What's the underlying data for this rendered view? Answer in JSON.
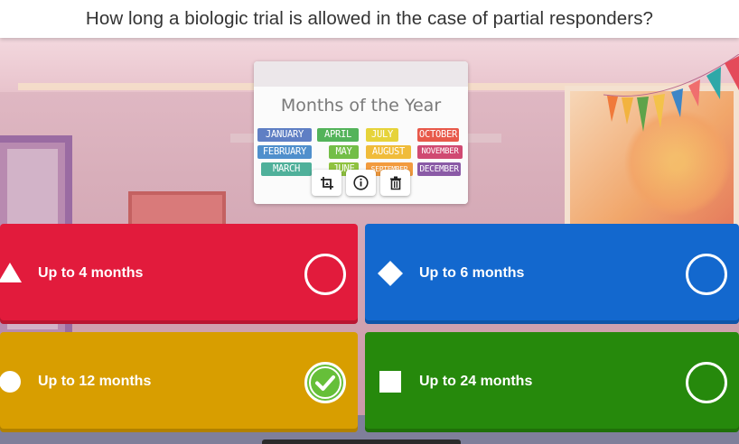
{
  "question": {
    "text": "How long a biologic trial is allowed in the case of partial responders?"
  },
  "media": {
    "title": "Months of the Year",
    "months": [
      {
        "label": "JANUARY",
        "color": "#5f7fc4"
      },
      {
        "label": "FEBRUARY",
        "color": "#4f8fcc"
      },
      {
        "label": "MARCH",
        "color": "#4fb09a"
      },
      {
        "label": "APRIL",
        "color": "#53b35a"
      },
      {
        "label": "MAY",
        "color": "#73be47"
      },
      {
        "label": "JUNE",
        "color": "#8fc23f"
      },
      {
        "label": "JULY",
        "color": "#e6d33a"
      },
      {
        "label": "AUGUST",
        "color": "#f0bc3a"
      },
      {
        "label": "SEPTEMBER",
        "color": "#f29b3e"
      },
      {
        "label": "OCTOBER",
        "color": "#e8594a"
      },
      {
        "label": "NOVEMBER",
        "color": "#d04a72"
      },
      {
        "label": "DECEMBER",
        "color": "#8a5aa6"
      }
    ],
    "tools": [
      {
        "icon": "crop-icon"
      },
      {
        "icon": "info-icon"
      },
      {
        "icon": "trash-icon"
      }
    ]
  },
  "answers": [
    {
      "label": "Up to 4 months",
      "shape": "triangle",
      "color": "#e21b3c",
      "checked": false
    },
    {
      "label": "Up to 6 months",
      "shape": "diamond",
      "color": "#1368ce",
      "checked": false
    },
    {
      "label": "Up to 12 months",
      "shape": "circle",
      "color": "#d89e00",
      "checked": true
    },
    {
      "label": "Up to 24 months",
      "shape": "square",
      "color": "#26890c",
      "checked": false
    }
  ],
  "colors": {
    "checkmark": "#66bf39"
  }
}
